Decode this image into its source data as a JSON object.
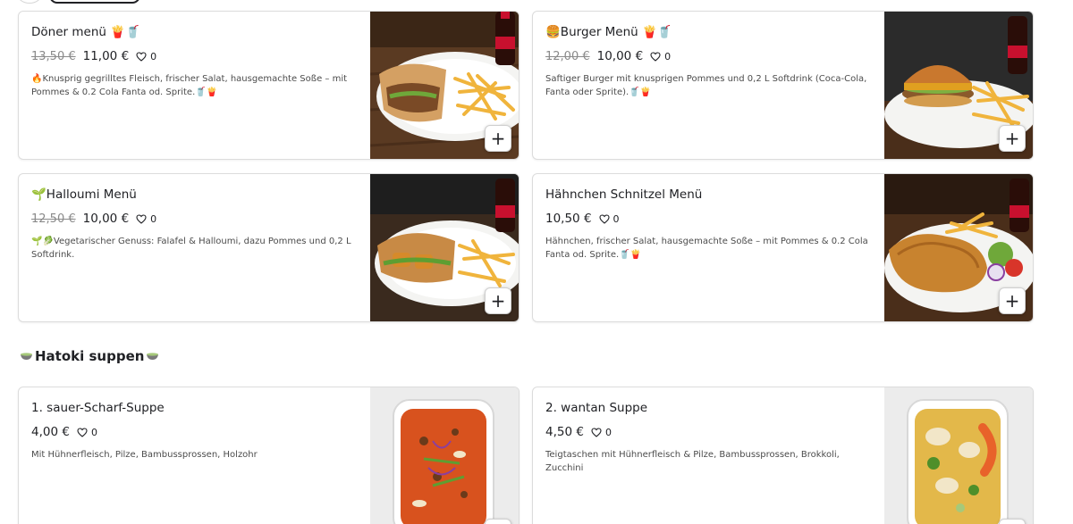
{
  "colors": {
    "card_border": "#dcdcdc",
    "text": "#202125",
    "muted": "#8a8a8a",
    "coca_cola_red": "#c8102e"
  },
  "cards": [
    {
      "title": "Döner menü 🍟🥤",
      "old_price": "13,50 €",
      "price": "11,00 €",
      "likes": "0",
      "description": "🔥Knusprig gegrilltes Fleisch, frischer Salat, hausgemachte Soße – mit Pommes & 0.2 Cola Fanta od. Sprite.🥤🍟",
      "image": "doener-menu-photo",
      "add_label": "+"
    },
    {
      "title": "🍔Burger Menü 🍟🥤",
      "old_price": "12,00 €",
      "price": "10,00 €",
      "likes": "0",
      "description": "Saftiger Burger mit knusprigen Pommes und 0,2 L Softdrink (Coca-Cola, Fanta oder Sprite).🥤🍟",
      "image": "burger-menu-photo",
      "add_label": "+"
    },
    {
      "title": "🌱Halloumi Menü",
      "old_price": "12,50 €",
      "price": "10,00 €",
      "likes": "0",
      "description": "🌱🥬Vegetarischer Genuss: Falafel & Halloumi, dazu Pommes und 0,2 L Softdrink.",
      "image": "halloumi-menu-photo",
      "add_label": "+"
    },
    {
      "title": "Hähnchen Schnitzel Menü",
      "old_price": "",
      "price": "10,50 €",
      "likes": "0",
      "description": "Hähnchen, frischer Salat, hausgemachte Soße – mit Pommes & 0.2 Cola Fanta od. Sprite.🥤🍟",
      "image": "schnitzel-menu-photo",
      "add_label": "+"
    },
    {
      "title": "1. sauer-Scharf-Suppe",
      "old_price": "",
      "price": "4,00 €",
      "likes": "0",
      "description": "Mit Hühnerfleisch, Pilze, Bambussprossen, Holzohr",
      "image": "sauer-scharf-suppe-photo",
      "add_label": "+"
    },
    {
      "title": "2. wantan Suppe",
      "old_price": "",
      "price": "4,50 €",
      "likes": "0",
      "description": "Teigtaschen mit Hühnerfleisch & Pilze, Bambussprossen, Brokkoli, Zucchini",
      "image": "wantan-suppe-photo",
      "add_label": "+"
    }
  ],
  "section": {
    "title": "Hatoki suppen"
  },
  "icons": {
    "heart": "heart-outline-icon",
    "bowl": "soup-bowl-icon"
  }
}
